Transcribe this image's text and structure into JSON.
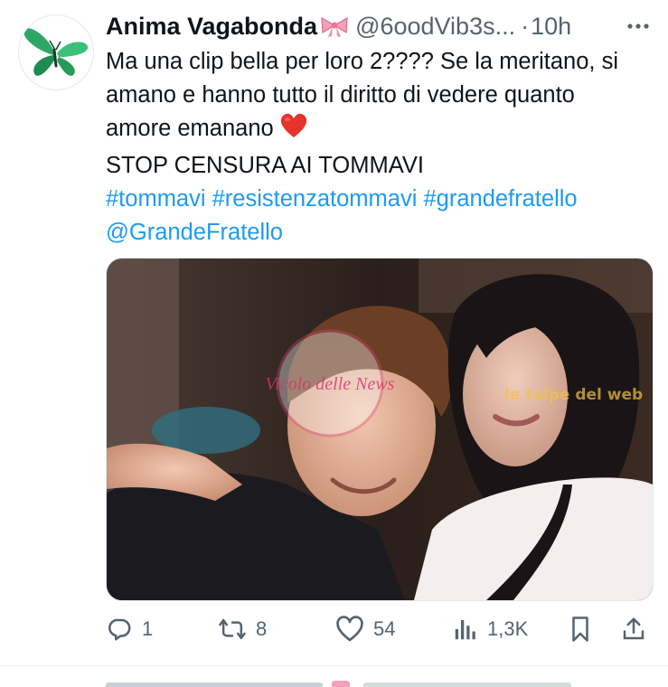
{
  "author": {
    "display_name": "Anima Vagabonda",
    "handle": "@6oodVib3s...",
    "separator": "·",
    "timestamp": "10h",
    "avatar_icon": "butterfly-icon",
    "name_emoji": "ribbon-bow-icon"
  },
  "tweet": {
    "lines": [
      "Ma una clip bella per loro 2???? Se la meritano, si",
      "amano e hanno tutto il diritto di vedere quanto",
      "amore emanano",
      "STOP CENSURA AI TOMMAVI"
    ],
    "hashtags": [
      "#tommavi",
      "#resistenzatommavi",
      "#grandefratello"
    ],
    "mention": "@GrandeFratello",
    "emoji": "red-heart-icon"
  },
  "media": {
    "watermark_center": "Vicolo delle News",
    "watermark_right": "le talpe del web"
  },
  "actions": {
    "replies": "1",
    "reposts": "8",
    "likes": "54",
    "views": "1,3K"
  },
  "colors": {
    "link": "#1d9bf0",
    "secondary_text": "#536471",
    "primary_text": "#0f1419",
    "butterfly": "#2e9e5e",
    "bow": "#f5a0b8"
  }
}
